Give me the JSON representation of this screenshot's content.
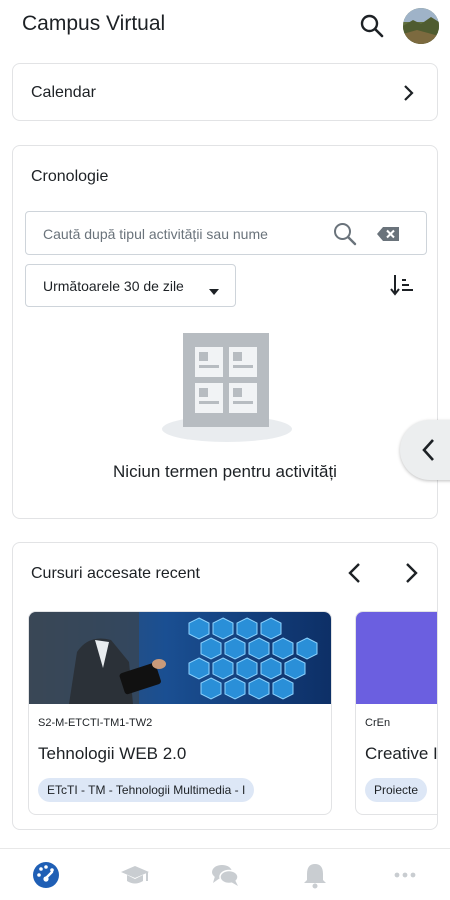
{
  "header": {
    "title": "Campus Virtual",
    "search_icon": "search-icon",
    "avatar_icon": "user-avatar"
  },
  "calendar": {
    "label": "Calendar",
    "icon": "chevron-right-icon"
  },
  "timeline": {
    "title": "Cronologie",
    "search_placeholder": "Caută după tipul activității sau nume",
    "filter_value": "Următoarele 30 de zile",
    "sort_icon": "sort-icon",
    "empty_message": "Niciun termen pentru activități"
  },
  "recent_courses": {
    "title": "Cursuri accesate recent",
    "courses": [
      {
        "short_name": "S2-M-ETCTI-TM1-TW2",
        "name": "Tehnologii WEB 2.0",
        "category": "ETcTI - TM - Tehnologii Multimedia - I"
      },
      {
        "short_name": "CrEn",
        "name": "Creative I",
        "category": "Proiecte",
        "color": "#6b5fe0"
      }
    ]
  },
  "bottom_nav": {
    "items": [
      "dashboard-icon",
      "courses-icon",
      "messages-icon",
      "notifications-icon",
      "more-icon"
    ],
    "active_color": "#1f5fb5",
    "inactive_color": "#c9cdd1"
  }
}
